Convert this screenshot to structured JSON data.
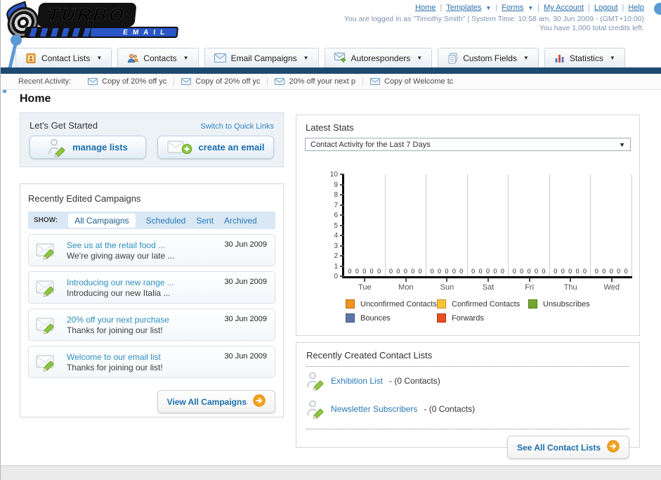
{
  "header": {
    "logo": {
      "line1": "TURBO",
      "line2": "EMAIL"
    },
    "nav_links": [
      {
        "label": "Home",
        "dropdown": false
      },
      {
        "label": "Templates",
        "dropdown": true
      },
      {
        "label": "Forms",
        "dropdown": true
      },
      {
        "label": "My Account",
        "dropdown": false
      },
      {
        "label": "Logout",
        "dropdown": false
      },
      {
        "label": "Help",
        "dropdown": false
      }
    ],
    "login_line": "You are logged in as \"Timothy Smith\" | System Time: 10:58 am, 30 Jun 2009 - (GMT+10:00)",
    "credits_line": "You have 1,000 total credits left."
  },
  "nav_tabs": [
    {
      "label": "Contact Lists",
      "icon": "address-book"
    },
    {
      "label": "Contacts",
      "icon": "contacts"
    },
    {
      "label": "Email Campaigns",
      "icon": "envelope-blue"
    },
    {
      "label": "Autoresponders",
      "icon": "autoresponder"
    },
    {
      "label": "Custom Fields",
      "icon": "custom-fields"
    },
    {
      "label": "Statistics",
      "icon": "statistics"
    }
  ],
  "recent_activity": {
    "label": "Recent Activity:",
    "items": [
      "Copy of 20% off yc",
      "Copy of 20% off yc",
      "20% off your next p",
      "Copy of Welcome tc"
    ]
  },
  "home_title": "Home",
  "get_started": {
    "title": "Let's Get Started",
    "switch_link": "Switch to Quick Links",
    "buttons": [
      {
        "label": "manage lists",
        "icon": "person-pencil"
      },
      {
        "label": "create an email",
        "icon": "envelope-plus"
      }
    ]
  },
  "campaigns": {
    "title": "Recently Edited Campaigns",
    "show_label": "SHOW:",
    "tabs": [
      "All Campaigns",
      "Scheduled",
      "Sent",
      "Archived"
    ],
    "active_tab": "All Campaigns",
    "items": [
      {
        "title": "See us at the retail food ...",
        "subtitle": "We're giving away our late ...",
        "date": "30 Jun 2009"
      },
      {
        "title": "Introducing our new range ...",
        "subtitle": "Introducing our new Italia ...",
        "date": "30 Jun 2009"
      },
      {
        "title": "20% off your next purchase",
        "subtitle": "Thanks for joining our list!",
        "date": "30 Jun 2009"
      },
      {
        "title": "Welcome to our email list",
        "subtitle": "Thanks for joining our list!",
        "date": "30 Jun 2009"
      }
    ],
    "view_all_label": "View All Campaigns"
  },
  "stats": {
    "title": "Latest Stats",
    "dropdown_value": "Contact Activity for the Last 7 Days"
  },
  "chart_data": {
    "type": "bar",
    "title": "Contact Activity for the Last 7 Days",
    "categories": [
      "Tue",
      "Mon",
      "Sun",
      "Sat",
      "Fri",
      "Thu",
      "Wed"
    ],
    "series": [
      {
        "name": "Unconfirmed Contacts",
        "color": "#f6921e",
        "values": [
          0,
          0,
          0,
          0,
          0,
          0,
          0
        ]
      },
      {
        "name": "Confirmed Contacts",
        "color": "#fbc437",
        "values": [
          0,
          0,
          0,
          0,
          0,
          0,
          0
        ]
      },
      {
        "name": "Unsubscribes",
        "color": "#74a52c",
        "values": [
          0,
          0,
          0,
          0,
          0,
          0,
          0
        ]
      },
      {
        "name": "Bounces",
        "color": "#5a76ab",
        "values": [
          0,
          0,
          0,
          0,
          0,
          0,
          0
        ]
      },
      {
        "name": "Forwards",
        "color": "#e94e23",
        "values": [
          0,
          0,
          0,
          0,
          0,
          0,
          0
        ]
      }
    ],
    "ylim": [
      0,
      10
    ],
    "yticks": [
      0,
      1,
      2,
      3,
      4,
      5,
      6,
      7,
      8,
      9,
      10
    ],
    "grid": true,
    "legend_position": "bottom",
    "value_labels_shown": true
  },
  "contact_lists": {
    "title": "Recently Created Contact Lists",
    "items": [
      {
        "name": "Exhibition List",
        "suffix": "- (0 Contacts)"
      },
      {
        "name": "Newsletter Subscribers",
        "suffix": "- (0 Contacts)"
      }
    ],
    "see_all_label": "See All Contact Lists"
  },
  "colors": {
    "navy_bar": "#1d4a70",
    "link_blue": "#2a6fae",
    "accent_blue": "#5b9bd5",
    "button_text_blue": "#1b6fad",
    "arrow_button_orange": "#f5a31d",
    "logo_blue": "#2a56c6"
  }
}
